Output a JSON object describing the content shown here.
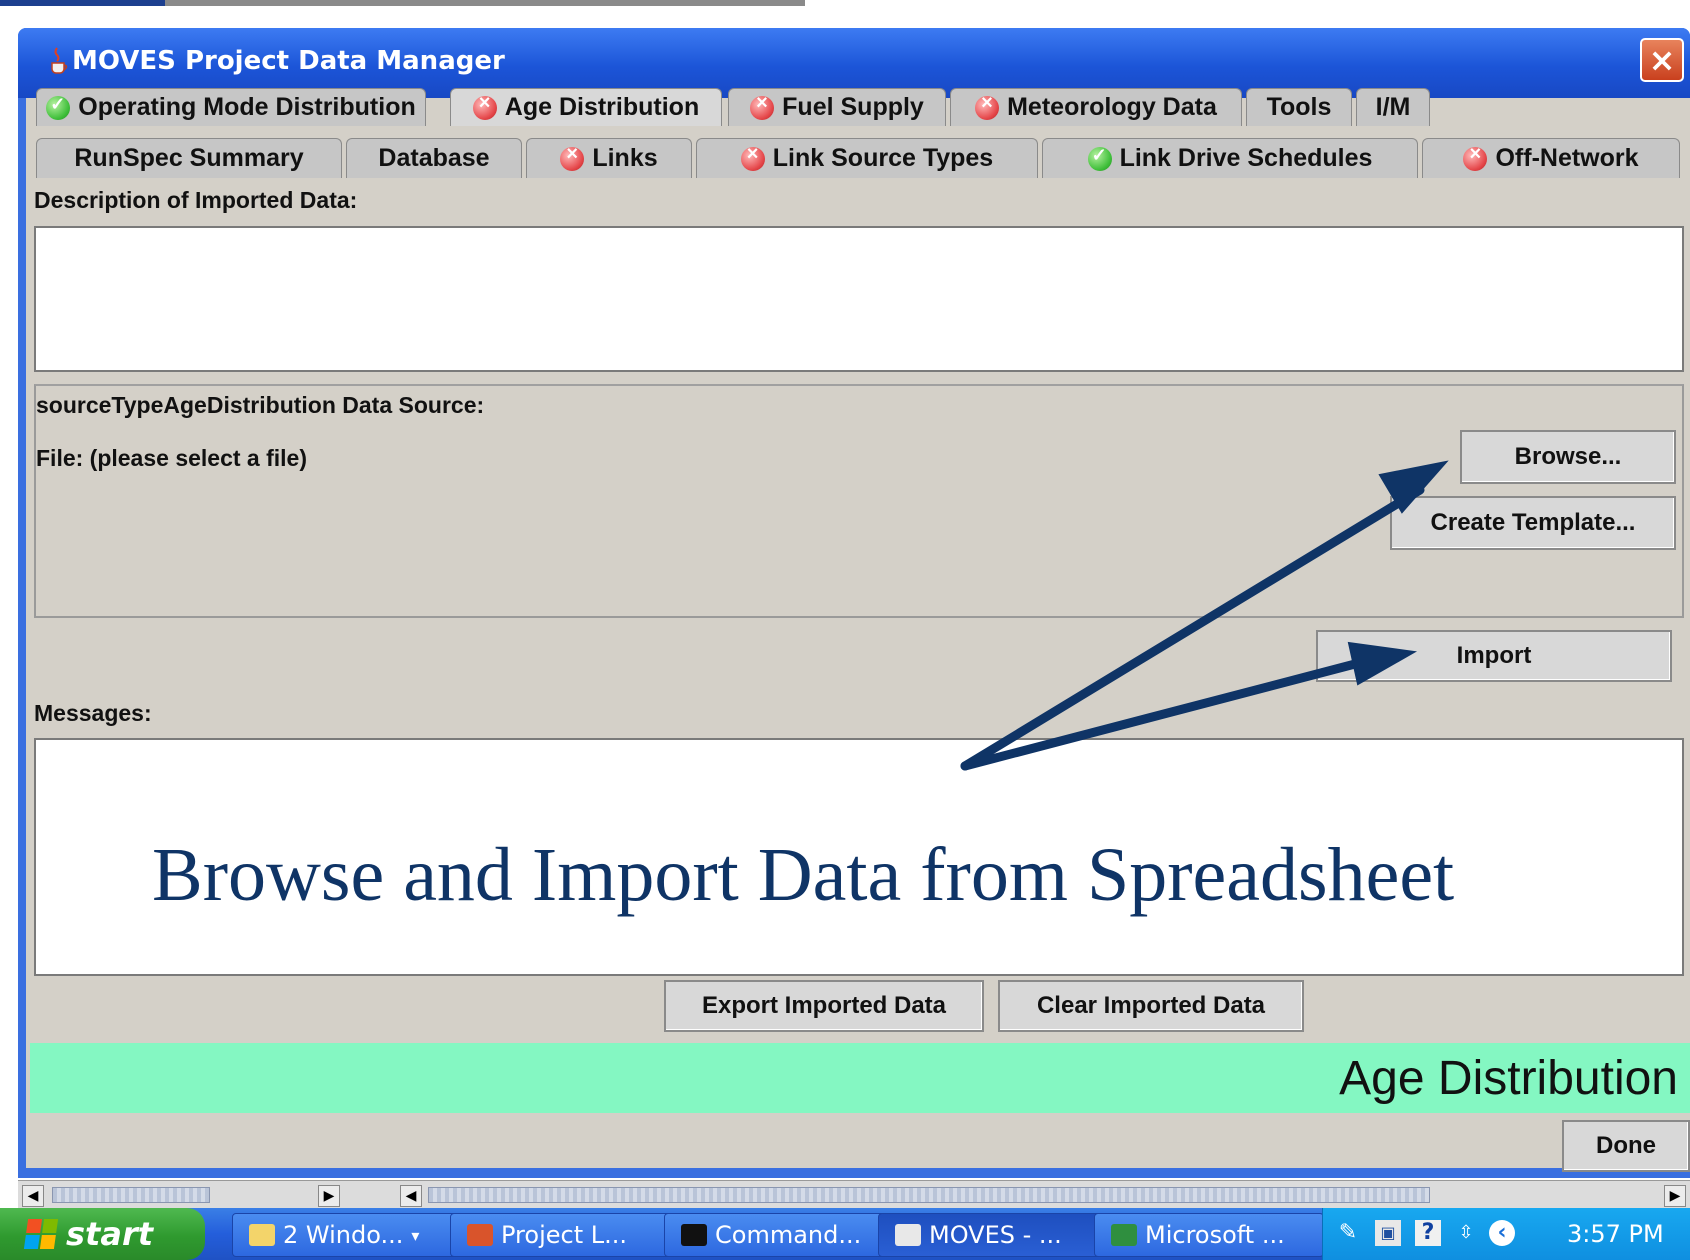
{
  "window": {
    "title": "MOVES Project Data Manager",
    "close_label": "×"
  },
  "tabs_row1": [
    {
      "label": "Operating Mode Distribution",
      "status": "ok"
    },
    {
      "label": "Age Distribution",
      "status": "error",
      "active": true
    },
    {
      "label": "Fuel Supply",
      "status": "error"
    },
    {
      "label": "Meteorology Data",
      "status": "error"
    },
    {
      "label": "Tools",
      "status": "none"
    },
    {
      "label": "I/M",
      "status": "none"
    }
  ],
  "tabs_row2": [
    {
      "label": "RunSpec Summary",
      "status": "none"
    },
    {
      "label": "Database",
      "status": "none"
    },
    {
      "label": "Links",
      "status": "error"
    },
    {
      "label": "Link Source Types",
      "status": "error"
    },
    {
      "label": "Link Drive Schedules",
      "status": "ok"
    },
    {
      "label": "Off-Network",
      "status": "error"
    }
  ],
  "description": {
    "label": "Description of Imported Data:",
    "value": ""
  },
  "datasource": {
    "label": "sourceTypeAgeDistribution Data Source:",
    "file_label": "File: (please select a file)",
    "browse_button": "Browse...",
    "template_button": "Create Template...",
    "import_button": "Import"
  },
  "messages": {
    "label": "Messages:",
    "value": ""
  },
  "annotation": "Browse and Import Data from Spreadsheet",
  "bottom_buttons": {
    "export": "Export Imported Data",
    "clear": "Clear Imported Data"
  },
  "banner": "Age Distribution",
  "done_button": "Done",
  "taskbar": {
    "start_label": "start",
    "items": [
      {
        "label": "2 Windo...",
        "icon": "folder-icon"
      },
      {
        "label": "Project L...",
        "icon": "powerpoint-icon"
      },
      {
        "label": "Command...",
        "icon": "console-icon"
      },
      {
        "label": "MOVES - ...",
        "icon": "java-icon"
      },
      {
        "label": "Microsoft ...",
        "icon": "excel-icon"
      }
    ],
    "clock": "3:57 PM"
  },
  "colors": {
    "title_bar": "#245edb",
    "annotation": "#0f3466",
    "banner": "#84f7c2",
    "arrow": "#0f3466"
  }
}
